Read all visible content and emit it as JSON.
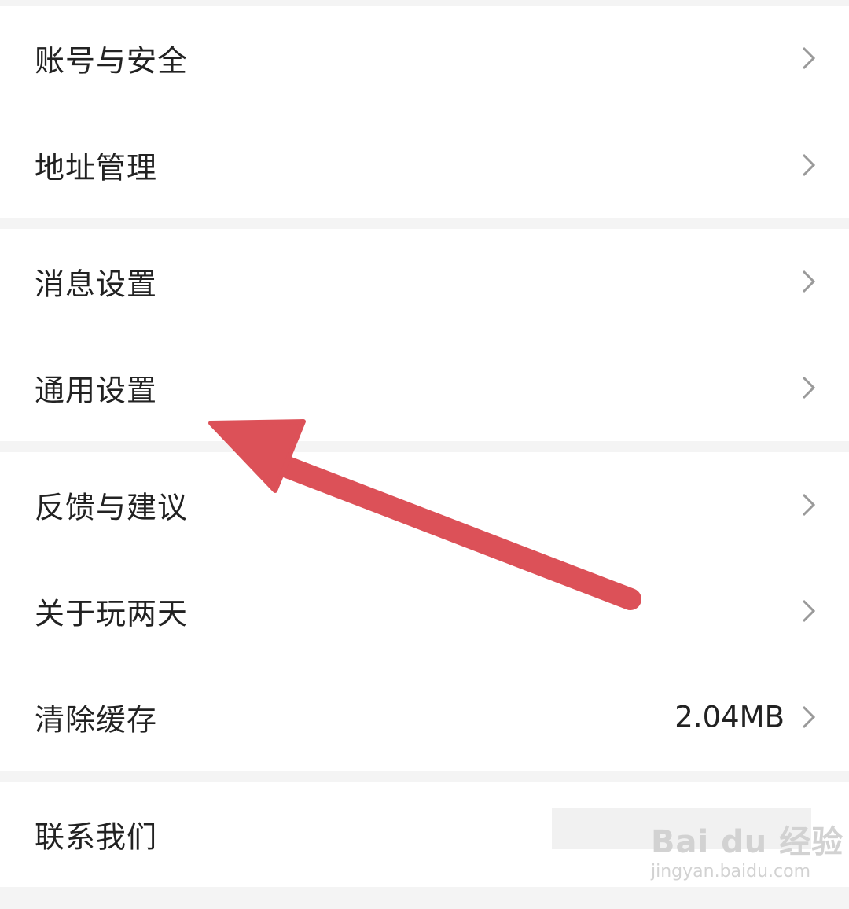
{
  "colors": {
    "page_bg": "#f4f4f4",
    "card_bg": "#ffffff",
    "text": "#222222",
    "chevron": "#9a9a9a",
    "arrow": "#dc5158",
    "watermark": "#d2d2d2"
  },
  "settings": {
    "groups": [
      {
        "items": [
          {
            "label": "账号与安全",
            "icon": "chevron-right-icon"
          },
          {
            "label": "地址管理",
            "icon": "chevron-right-icon"
          }
        ]
      },
      {
        "items": [
          {
            "label": "消息设置",
            "icon": "chevron-right-icon"
          },
          {
            "label": "通用设置",
            "icon": "chevron-right-icon"
          }
        ]
      },
      {
        "items": [
          {
            "label": "反馈与建议",
            "icon": "chevron-right-icon"
          },
          {
            "label": "关于玩两天",
            "icon": "chevron-right-icon"
          },
          {
            "label": "清除缓存",
            "value": "2.04MB",
            "icon": "chevron-right-icon"
          }
        ]
      },
      {
        "items": [
          {
            "label": "联系我们"
          }
        ]
      }
    ]
  },
  "annotation": {
    "type": "arrow",
    "points_to": "通用设置",
    "icon": "arrow-annotation"
  },
  "watermark": {
    "main": "Bai du 经验",
    "sub": "jingyan.baidu.com"
  }
}
